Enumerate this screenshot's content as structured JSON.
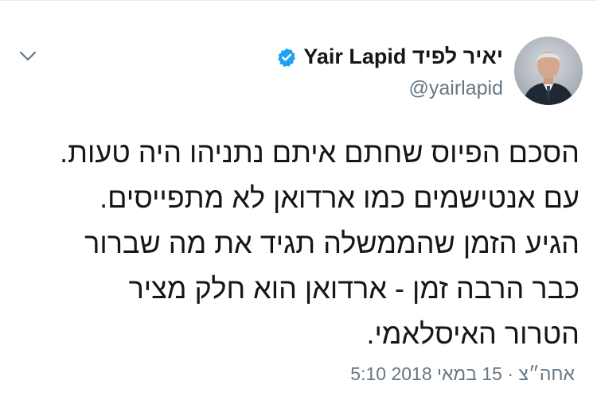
{
  "tweet": {
    "author_name": "Yair Lapid יאיר לפיד",
    "handle": "@yairlapid",
    "verified": true,
    "lines": [
      "הסכם הפיוס שחתם איתם נתניהו היה טעות.",
      "עם אנטישמים כמו ארדואן לא מתפייסים.",
      "הגיע הזמן שהממשלה תגיד את מה שברור",
      "כבר הרבה זמן - ארדואן הוא חלק מציר",
      "הטרור האיסלאמי."
    ],
    "timestamp": "5:10 אחה״צ · 15 במאי 2018"
  },
  "icons": {
    "more": "chevron-down-icon",
    "verified": "verified-badge-icon"
  },
  "colors": {
    "text": "#14171a",
    "secondary": "#657786",
    "verified": "#1da1f2"
  }
}
